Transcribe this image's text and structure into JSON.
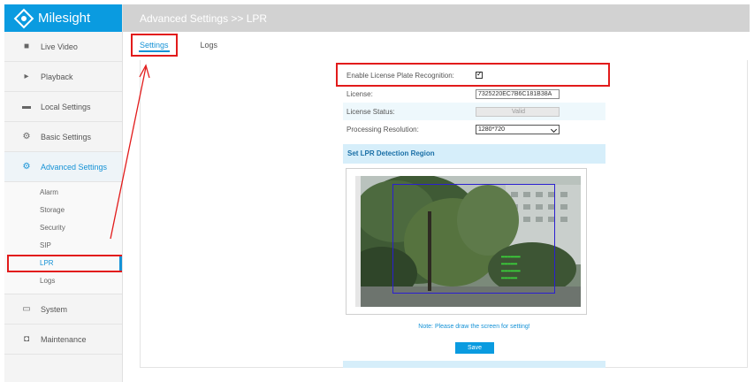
{
  "app": {
    "brand": "Milesight"
  },
  "header": {
    "title": "Advanced Settings >> LPR"
  },
  "sidebar": {
    "items": [
      {
        "label": "Live Video",
        "icon": "video-camera-icon"
      },
      {
        "label": "Playback",
        "icon": "play-icon"
      },
      {
        "label": "Local Settings",
        "icon": "folder-icon"
      },
      {
        "label": "Basic Settings",
        "icon": "gear-icon"
      },
      {
        "label": "Advanced Settings",
        "icon": "gears-icon"
      },
      {
        "label": "System",
        "icon": "monitor-icon"
      },
      {
        "label": "Maintenance",
        "icon": "camera-icon"
      }
    ],
    "subitems": [
      "Alarm",
      "Storage",
      "Security",
      "SIP",
      "LPR",
      "Logs"
    ]
  },
  "tabs": [
    "Settings",
    "Logs"
  ],
  "form": {
    "enable_label": "Enable License Plate Recognition:",
    "enable_checked": true,
    "license_label": "License:",
    "license_value": "7325220EC7B6C181B38A",
    "status_label": "License Status:",
    "status_value": "Valid",
    "resolution_label": "Processing Resolution:",
    "resolution_value": "1280*720"
  },
  "detection": {
    "title": "Set LPR Detection Region",
    "note": "Note: Please draw the screen for setting!",
    "save_label": "Save"
  },
  "colors": {
    "accent": "#0a9be0",
    "highlight_red": "#e21b1b",
    "header_gray": "#d2d2d2",
    "region_blue": "#2b1fd1"
  }
}
